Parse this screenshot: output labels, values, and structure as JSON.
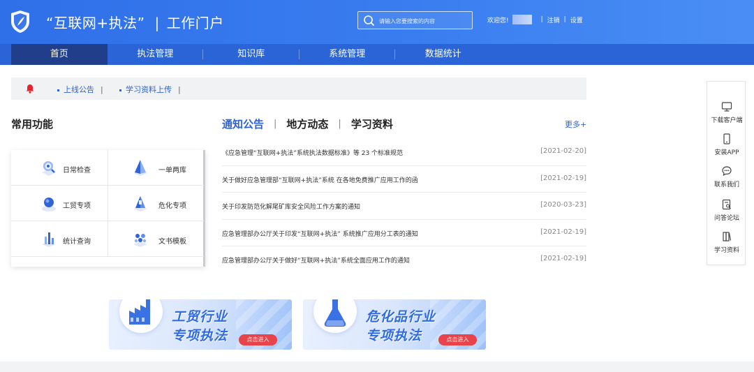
{
  "header": {
    "title": "“互联网+执法”",
    "subtitle": "工作门户",
    "title_separator": "|",
    "search_placeholder": "请输入您要搜索的内容",
    "welcome": "欢迎您!",
    "logout": "注销",
    "settings": "设置",
    "divider": "|"
  },
  "nav": {
    "items": [
      {
        "label": "首页",
        "active": true
      },
      {
        "label": "执法管理"
      },
      {
        "label": "知识库"
      },
      {
        "label": "系统管理"
      },
      {
        "label": "数据统计"
      }
    ]
  },
  "notice_bar": {
    "links": [
      "上线公告",
      "学习资料上传"
    ],
    "pipe": "|"
  },
  "functions": {
    "title": "常用功能",
    "items": [
      {
        "label": "日常检查",
        "icon": "search-shield-icon"
      },
      {
        "label": "一单两库",
        "icon": "pyramid-icon"
      },
      {
        "label": "工贸专项",
        "icon": "globe-icon"
      },
      {
        "label": "危化专项",
        "icon": "cone-icon"
      },
      {
        "label": "统计查询",
        "icon": "bar-chart-icon"
      },
      {
        "label": "文书模板",
        "icon": "cubes-icon"
      }
    ]
  },
  "news": {
    "tabs": [
      "通知公告",
      "地方动态",
      "学习资料"
    ],
    "tab_separator": "|",
    "more": "更多+",
    "items": [
      {
        "title": "《应急管理“互联网+执法”系统执法数据标准》等 23 个标准规范",
        "date": "[2021-02-20]"
      },
      {
        "title": "关于做好应急管理部“互联网+执法”系统 在各地免费推广应用工作的函",
        "date": "[2021-02-19]"
      },
      {
        "title": "关于印发防范化解尾矿库安全风险工作方案的通知",
        "date": "[2020-03-23]"
      },
      {
        "title": "应急管理部办公厅关于印发“互联网+执法” 系统推广应用分工表的通知",
        "date": "[2021-02-19]"
      },
      {
        "title": "应急管理部办公厅关于做好“互联网+执法”系统全面应用工作的通知",
        "date": "[2021-02-19]"
      }
    ]
  },
  "banners": [
    {
      "line1": "工贸行业",
      "line2": "专项执法",
      "button": "点击进入"
    },
    {
      "line1": "危化品行业",
      "line2": "专项执法",
      "button": "点击进入"
    }
  ],
  "sidebar": {
    "items": [
      {
        "label": "下载客户端",
        "icon": "monitor-icon"
      },
      {
        "label": "安装APP",
        "icon": "phone-icon"
      },
      {
        "label": "联系我们",
        "icon": "chat-icon"
      },
      {
        "label": "问答论坛",
        "icon": "forum-icon"
      },
      {
        "label": "学习资料",
        "icon": "books-icon"
      }
    ]
  },
  "colors": {
    "header_blue": "#3a7df0",
    "nav_blue": "#2a64d6",
    "nav_active": "#203e8a",
    "accent": "#2d63d8",
    "alert_red": "#e8424a"
  }
}
